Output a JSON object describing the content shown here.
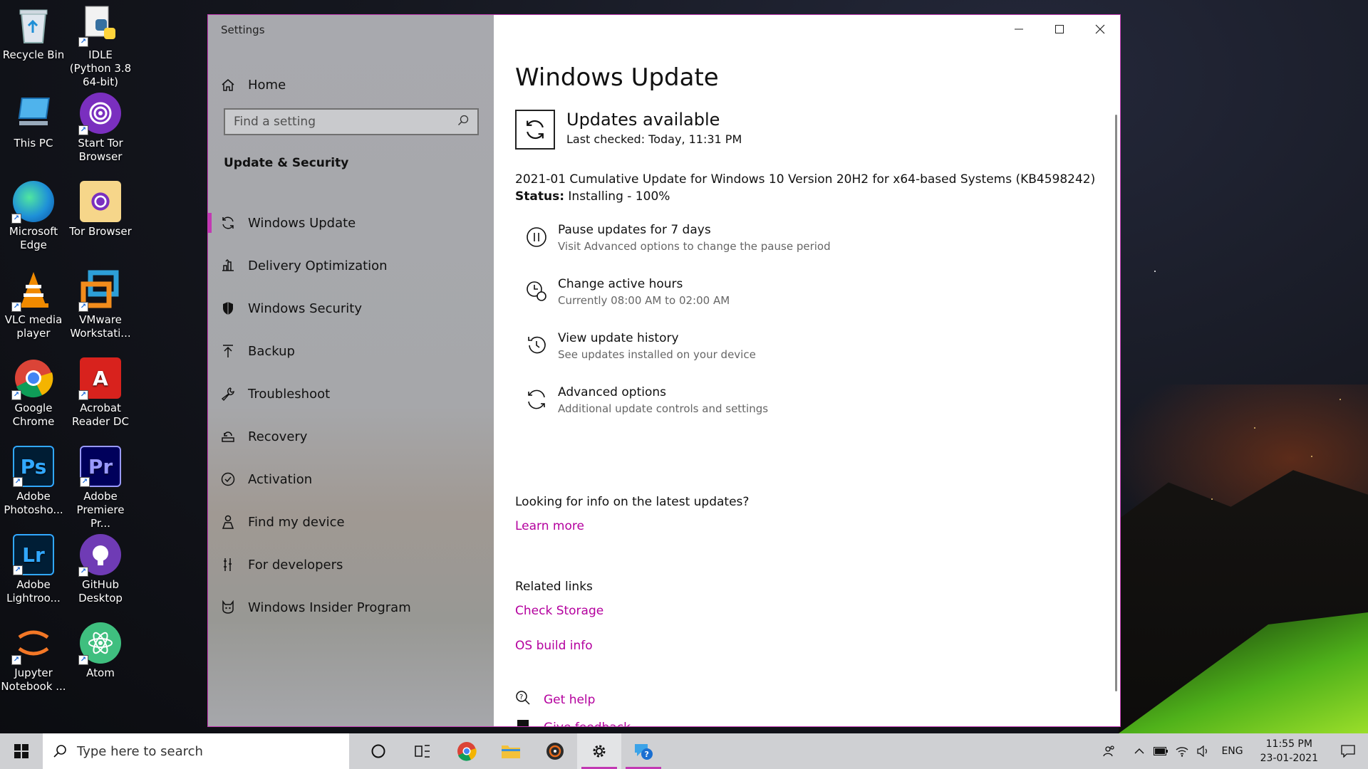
{
  "desktop": {
    "icons": [
      {
        "label": "Recycle Bin",
        "icon": "recycle-bin-icon"
      },
      {
        "label": "IDLE (Python 3.8 64-bit)",
        "icon": "python-idle-icon"
      },
      {
        "label": "This PC",
        "icon": "computer-icon"
      },
      {
        "label": "Start Tor Browser",
        "icon": "tor-icon"
      },
      {
        "label": "Microsoft Edge",
        "icon": "edge-icon"
      },
      {
        "label": "Tor Browser",
        "icon": "tor-folder-icon"
      },
      {
        "label": "VLC media player",
        "icon": "vlc-icon"
      },
      {
        "label": "VMware Workstati...",
        "icon": "vmware-icon"
      },
      {
        "label": "Google Chrome",
        "icon": "chrome-icon"
      },
      {
        "label": "Acrobat Reader DC",
        "icon": "acrobat-icon",
        "glyph": "A"
      },
      {
        "label": "Adobe Photosho...",
        "icon": "photoshop-icon",
        "glyph": "Ps"
      },
      {
        "label": "Adobe Premiere Pr...",
        "icon": "premiere-icon",
        "glyph": "Pr"
      },
      {
        "label": "Adobe Lightroo...",
        "icon": "lightroom-icon",
        "glyph": "Lr"
      },
      {
        "label": "GitHub Desktop",
        "icon": "github-icon"
      },
      {
        "label": "Jupyter Notebook ...",
        "icon": "jupyter-icon"
      },
      {
        "label": "Atom",
        "icon": "atom-icon"
      }
    ]
  },
  "window": {
    "title": "Settings",
    "nav": {
      "home_label": "Home",
      "search_placeholder": "Find a setting",
      "section_title": "Update & Security",
      "items": [
        {
          "label": "Windows Update",
          "icon": "refresh-icon",
          "active": true
        },
        {
          "label": "Delivery Optimization",
          "icon": "delivery-icon"
        },
        {
          "label": "Windows Security",
          "icon": "shield-icon"
        },
        {
          "label": "Backup",
          "icon": "backup-arrow-icon"
        },
        {
          "label": "Troubleshoot",
          "icon": "wrench-icon"
        },
        {
          "label": "Recovery",
          "icon": "recovery-icon"
        },
        {
          "label": "Activation",
          "icon": "check-circle-icon"
        },
        {
          "label": "Find my device",
          "icon": "person-locate-icon"
        },
        {
          "label": "For developers",
          "icon": "developer-icon"
        },
        {
          "label": "Windows Insider Program",
          "icon": "insider-cat-icon"
        }
      ]
    },
    "content": {
      "title": "Windows Update",
      "status_heading": "Updates available",
      "last_checked": "Last checked: Today, 11:31 PM",
      "update_name": "2021-01 Cumulative Update for Windows 10 Version 20H2 for x64-based Systems (KB4598242)",
      "status_label": "Status:",
      "status_value": " Installing - 100%",
      "options": [
        {
          "title": "Pause updates for 7 days",
          "subtitle": "Visit Advanced options to change the pause period",
          "icon": "pause-icon"
        },
        {
          "title": "Change active hours",
          "subtitle": "Currently 08:00 AM to 02:00 AM",
          "icon": "clock-icon"
        },
        {
          "title": "View update history",
          "subtitle": "See updates installed on your device",
          "icon": "history-icon"
        },
        {
          "title": "Advanced options",
          "subtitle": "Additional update controls and settings",
          "icon": "advanced-sync-icon"
        }
      ],
      "info_question": "Looking for info on the latest updates?",
      "learn_more": "Learn more",
      "related_title": "Related links",
      "check_storage": "Check Storage",
      "os_build_info": "OS build info",
      "get_help": "Get help",
      "give_feedback": "Give feedback"
    }
  },
  "taskbar": {
    "search_placeholder": "Type here to search",
    "language": "ENG",
    "time": "11:55 PM",
    "date": "23-01-2021"
  },
  "colors": {
    "accent": "#c239b3",
    "link": "#b4009e"
  }
}
